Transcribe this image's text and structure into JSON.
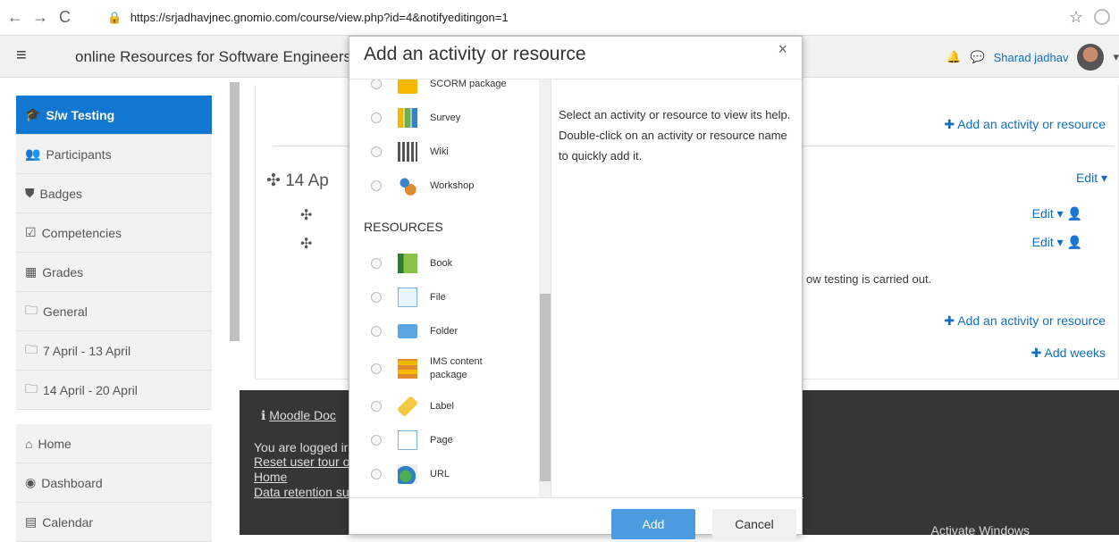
{
  "browser": {
    "url": "https://srjadhavjnec.gnomio.com/course/view.php?id=4&notifyeditingon=1"
  },
  "header": {
    "site_name": "online Resources for Software Engineers",
    "user_name": "Sharad jadhav"
  },
  "sidebar": {
    "items": [
      {
        "label": "S/w Testing",
        "icon": "graduation-cap-icon",
        "active": true
      },
      {
        "label": "Participants",
        "icon": "users-icon"
      },
      {
        "label": "Badges",
        "icon": "shield-icon"
      },
      {
        "label": "Competencies",
        "icon": "checkbox-icon"
      },
      {
        "label": "Grades",
        "icon": "table-icon"
      },
      {
        "label": "General",
        "icon": "folder-icon"
      },
      {
        "label": "7 April - 13 April",
        "icon": "folder-icon"
      },
      {
        "label": "14 April - 20 April",
        "icon": "folder-icon"
      }
    ],
    "bottom_items": [
      {
        "label": "Home",
        "icon": "home-icon"
      },
      {
        "label": "Dashboard",
        "icon": "dashboard-icon"
      },
      {
        "label": "Calendar",
        "icon": "calendar-icon"
      }
    ]
  },
  "main": {
    "section_title": "14 Ap",
    "add_activity_1": "Add an activity or resource",
    "edit": "Edit",
    "edit_2": "Edit",
    "edit_3": "Edit",
    "body_text": "ow testing is carried out.",
    "add_activity_2": "Add an activity or resource",
    "add_weeks": "Add weeks"
  },
  "footer": {
    "moodle_docs": "Moodle Doc",
    "logged_in": "You are logged ir",
    "reset_tour": "Reset user tour o",
    "home": "Home",
    "data_retention": "Data retention su"
  },
  "modal": {
    "title": "Add an activity or resource",
    "activities": [
      {
        "label": "SCORM package",
        "icon": "scorm-icon"
      },
      {
        "label": "Survey",
        "icon": "survey-icon"
      },
      {
        "label": "Wiki",
        "icon": "wiki-icon"
      },
      {
        "label": "Workshop",
        "icon": "workshop-icon"
      }
    ],
    "resources_heading": "RESOURCES",
    "resources": [
      {
        "label": "Book",
        "icon": "book-icon"
      },
      {
        "label": "File",
        "icon": "file-icon"
      },
      {
        "label": "Folder",
        "icon": "folder-icon"
      },
      {
        "label": "IMS content package",
        "icon": "ims-icon"
      },
      {
        "label": "Label",
        "icon": "label-icon"
      },
      {
        "label": "Page",
        "icon": "page-icon"
      },
      {
        "label": "URL",
        "icon": "url-icon"
      }
    ],
    "help_text": "Select an activity or resource to view its help. Double-click on an activity or resource name to quickly add it.",
    "add_button": "Add",
    "cancel_button": "Cancel"
  },
  "watermark": "Activate Windows"
}
